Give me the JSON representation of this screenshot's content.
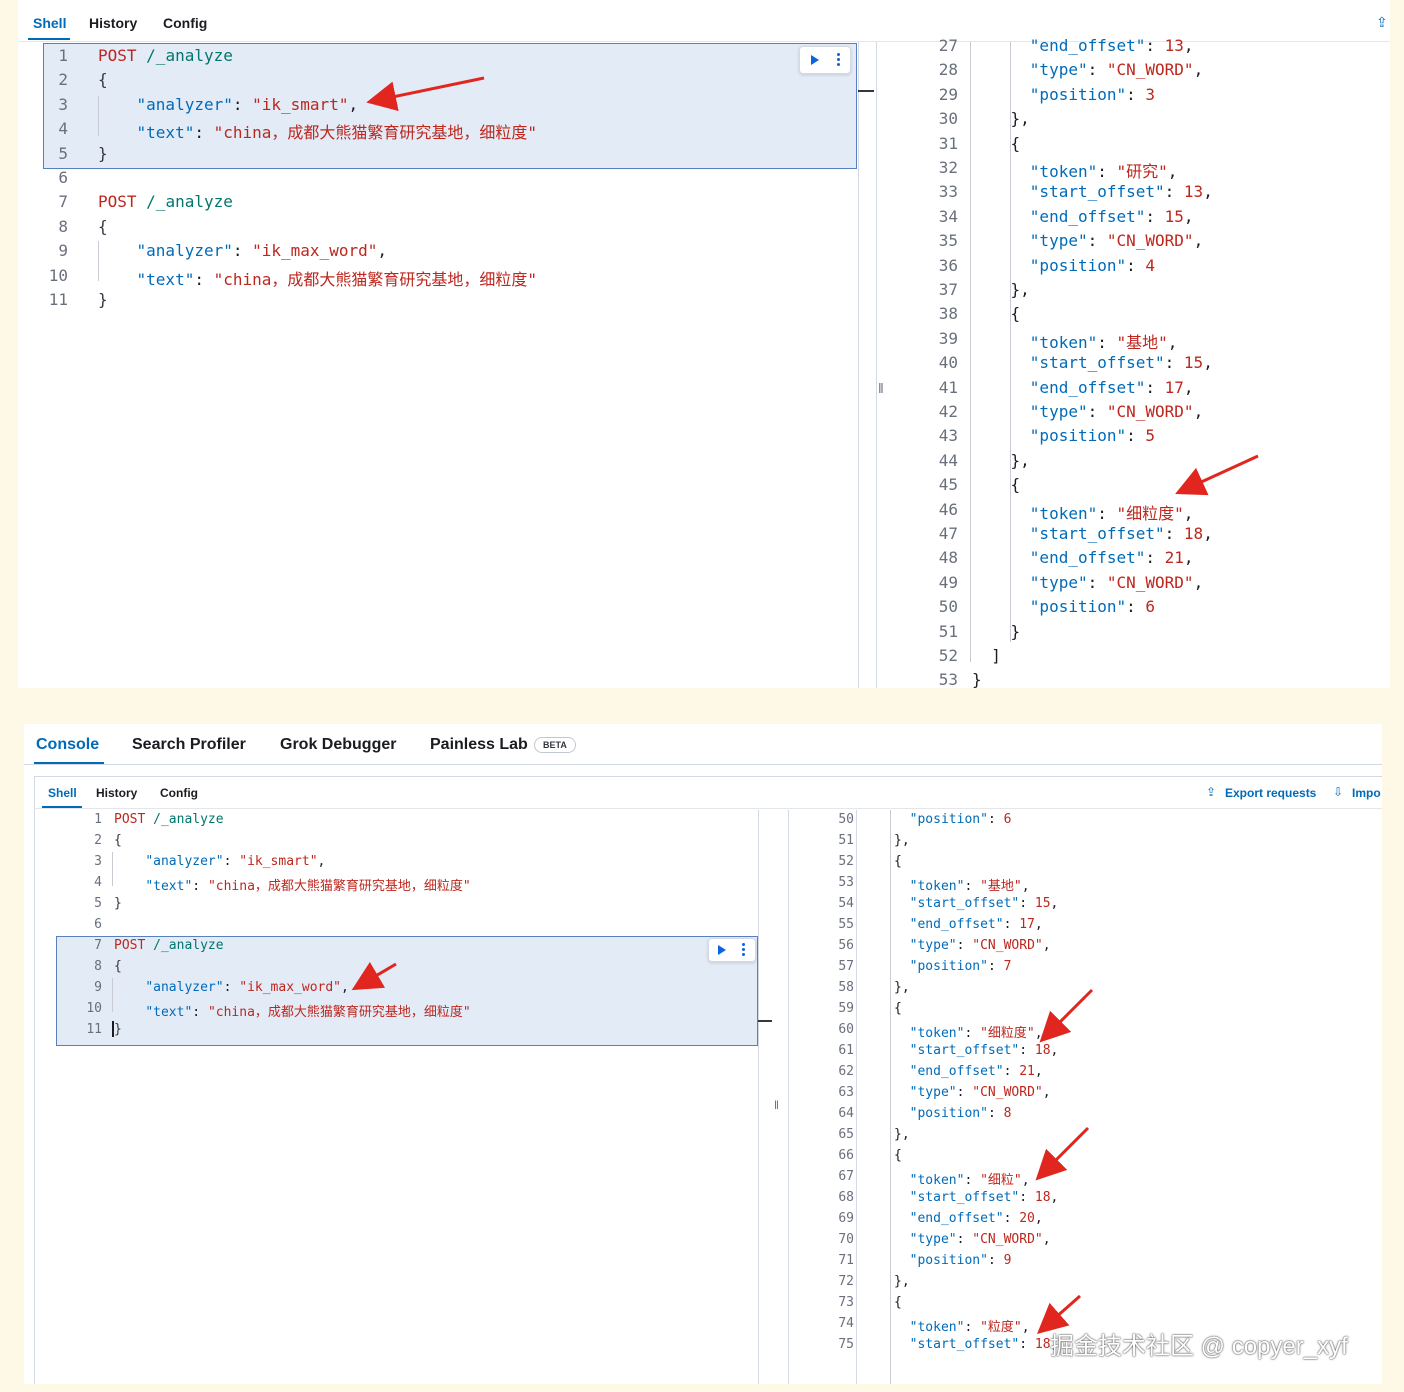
{
  "top": {
    "tabs": [
      "Shell",
      "History",
      "Config"
    ],
    "active_tab": "Shell",
    "left_lines": [
      {
        "n": "1",
        "html": "<span class='k-method'>POST</span> <span class='k-url'>/_analyze</span>"
      },
      {
        "n": "2",
        "html": "<span class='k-punc'>{</span>"
      },
      {
        "n": "3",
        "html": "    <span class='k-key'>\"analyzer\"</span>: <span class='k-str'>\"ik_smart\"</span>,"
      },
      {
        "n": "4",
        "html": "    <span class='k-key'>\"text\"</span>: <span class='k-str'>\"china，成都大熊猫繁育研究基地，细粒度\"</span>"
      },
      {
        "n": "5",
        "html": "<span class='k-punc'>}</span>"
      },
      {
        "n": "6",
        "html": ""
      },
      {
        "n": "7",
        "html": "<span class='k-method'>POST</span> <span class='k-url'>/_analyze</span>"
      },
      {
        "n": "8",
        "html": "<span class='k-punc'>{</span>"
      },
      {
        "n": "9",
        "html": "    <span class='k-key'>\"analyzer\"</span>: <span class='k-str'>\"ik_max_word\"</span>,"
      },
      {
        "n": "10",
        "html": "    <span class='k-key'>\"text\"</span>: <span class='k-str'>\"china，成都大熊猫繁育研究基地，细粒度\"</span>"
      },
      {
        "n": "11",
        "html": "<span class='k-punc'>}</span>"
      }
    ],
    "right_lines": [
      {
        "n": "27",
        "html": "      <span class='k-key'>\"end_offset\"</span>: <span class='k-num'>13</span>,"
      },
      {
        "n": "28",
        "html": "      <span class='k-key'>\"type\"</span>: <span class='k-str'>\"CN_WORD\"</span>,"
      },
      {
        "n": "29",
        "html": "      <span class='k-key'>\"position\"</span>: <span class='k-num'>3</span>"
      },
      {
        "n": "30",
        "html": "    },"
      },
      {
        "n": "31",
        "html": "    {"
      },
      {
        "n": "32",
        "html": "      <span class='k-key'>\"token\"</span>: <span class='k-str'>\"研究\"</span>,"
      },
      {
        "n": "33",
        "html": "      <span class='k-key'>\"start_offset\"</span>: <span class='k-num'>13</span>,"
      },
      {
        "n": "34",
        "html": "      <span class='k-key'>\"end_offset\"</span>: <span class='k-num'>15</span>,"
      },
      {
        "n": "35",
        "html": "      <span class='k-key'>\"type\"</span>: <span class='k-str'>\"CN_WORD\"</span>,"
      },
      {
        "n": "36",
        "html": "      <span class='k-key'>\"position\"</span>: <span class='k-num'>4</span>"
      },
      {
        "n": "37",
        "html": "    },"
      },
      {
        "n": "38",
        "html": "    {"
      },
      {
        "n": "39",
        "html": "      <span class='k-key'>\"token\"</span>: <span class='k-str'>\"基地\"</span>,"
      },
      {
        "n": "40",
        "html": "      <span class='k-key'>\"start_offset\"</span>: <span class='k-num'>15</span>,"
      },
      {
        "n": "41",
        "html": "      <span class='k-key'>\"end_offset\"</span>: <span class='k-num'>17</span>,"
      },
      {
        "n": "42",
        "html": "      <span class='k-key'>\"type\"</span>: <span class='k-str'>\"CN_WORD\"</span>,"
      },
      {
        "n": "43",
        "html": "      <span class='k-key'>\"position\"</span>: <span class='k-num'>5</span>"
      },
      {
        "n": "44",
        "html": "    },"
      },
      {
        "n": "45",
        "html": "    {"
      },
      {
        "n": "46",
        "html": "      <span class='k-key'>\"token\"</span>: <span class='k-str'>\"细粒度\"</span>,"
      },
      {
        "n": "47",
        "html": "      <span class='k-key'>\"start_offset\"</span>: <span class='k-num'>18</span>,"
      },
      {
        "n": "48",
        "html": "      <span class='k-key'>\"end_offset\"</span>: <span class='k-num'>21</span>,"
      },
      {
        "n": "49",
        "html": "      <span class='k-key'>\"type\"</span>: <span class='k-str'>\"CN_WORD\"</span>,"
      },
      {
        "n": "50",
        "html": "      <span class='k-key'>\"position\"</span>: <span class='k-num'>6</span>"
      },
      {
        "n": "51",
        "html": "    }"
      },
      {
        "n": "52",
        "html": "  ]"
      },
      {
        "n": "53",
        "html": "}"
      }
    ]
  },
  "bottom": {
    "app_tabs": [
      "Console",
      "Search Profiler",
      "Grok Debugger",
      "Painless Lab"
    ],
    "active_app_tab": "Console",
    "beta_badge": "BETA",
    "tabs": [
      "Shell",
      "History",
      "Config"
    ],
    "active_tab": "Shell",
    "export_label": "Export requests",
    "import_label": "Impo",
    "left_lines": [
      {
        "n": "1",
        "html": "<span class='k-method'>POST</span> <span class='k-url'>/_analyze</span>"
      },
      {
        "n": "2",
        "html": "<span class='k-punc'>{</span>"
      },
      {
        "n": "3",
        "html": "    <span class='k-key'>\"analyzer\"</span>: <span class='k-str'>\"ik_smart\"</span>,"
      },
      {
        "n": "4",
        "html": "    <span class='k-key'>\"text\"</span>: <span class='k-str'>\"china，成都大熊猫繁育研究基地，细粒度\"</span>"
      },
      {
        "n": "5",
        "html": "<span class='k-punc'>}</span>"
      },
      {
        "n": "6",
        "html": ""
      },
      {
        "n": "7",
        "html": "<span class='k-method'>POST</span> <span class='k-url'>/_analyze</span>"
      },
      {
        "n": "8",
        "html": "<span class='k-punc'>{</span>"
      },
      {
        "n": "9",
        "html": "    <span class='k-key'>\"analyzer\"</span>: <span class='k-str'>\"ik_max_word\"</span>,"
      },
      {
        "n": "10",
        "html": "    <span class='k-key'>\"text\"</span>: <span class='k-str'>\"china，成都大熊猫繁育研究基地，细粒度\"</span>"
      },
      {
        "n": "11",
        "html": "<span class='k-punc'>}</span>"
      }
    ],
    "right_lines": [
      {
        "n": "50",
        "html": "  <span class='k-key'>\"position\"</span>: <span class='k-num'>6</span>"
      },
      {
        "n": "51",
        "html": "},"
      },
      {
        "n": "52",
        "html": "{"
      },
      {
        "n": "53",
        "html": "  <span class='k-key'>\"token\"</span>: <span class='k-str'>\"基地\"</span>,"
      },
      {
        "n": "54",
        "html": "  <span class='k-key'>\"start_offset\"</span>: <span class='k-num'>15</span>,"
      },
      {
        "n": "55",
        "html": "  <span class='k-key'>\"end_offset\"</span>: <span class='k-num'>17</span>,"
      },
      {
        "n": "56",
        "html": "  <span class='k-key'>\"type\"</span>: <span class='k-str'>\"CN_WORD\"</span>,"
      },
      {
        "n": "57",
        "html": "  <span class='k-key'>\"position\"</span>: <span class='k-num'>7</span>"
      },
      {
        "n": "58",
        "html": "},"
      },
      {
        "n": "59",
        "html": "{"
      },
      {
        "n": "60",
        "html": "  <span class='k-key'>\"token\"</span>: <span class='k-str'>\"细粒度\"</span>,"
      },
      {
        "n": "61",
        "html": "  <span class='k-key'>\"start_offset\"</span>: <span class='k-num'>18</span>,"
      },
      {
        "n": "62",
        "html": "  <span class='k-key'>\"end_offset\"</span>: <span class='k-num'>21</span>,"
      },
      {
        "n": "63",
        "html": "  <span class='k-key'>\"type\"</span>: <span class='k-str'>\"CN_WORD\"</span>,"
      },
      {
        "n": "64",
        "html": "  <span class='k-key'>\"position\"</span>: <span class='k-num'>8</span>"
      },
      {
        "n": "65",
        "html": "},"
      },
      {
        "n": "66",
        "html": "{"
      },
      {
        "n": "67",
        "html": "  <span class='k-key'>\"token\"</span>: <span class='k-str'>\"细粒\"</span>,"
      },
      {
        "n": "68",
        "html": "  <span class='k-key'>\"start_offset\"</span>: <span class='k-num'>18</span>,"
      },
      {
        "n": "69",
        "html": "  <span class='k-key'>\"end_offset\"</span>: <span class='k-num'>20</span>,"
      },
      {
        "n": "70",
        "html": "  <span class='k-key'>\"type\"</span>: <span class='k-str'>\"CN_WORD\"</span>,"
      },
      {
        "n": "71",
        "html": "  <span class='k-key'>\"position\"</span>: <span class='k-num'>9</span>"
      },
      {
        "n": "72",
        "html": "},"
      },
      {
        "n": "73",
        "html": "{"
      },
      {
        "n": "74",
        "html": "  <span class='k-key'>\"token\"</span>: <span class='k-str'>\"粒度\"</span>,"
      },
      {
        "n": "75",
        "html": "  <span class='k-key'>\"start_offset\"</span>: <span class='k-num'>18</span>,"
      }
    ]
  },
  "watermark": "掘金技术社区 @ copyer_xyf",
  "colors": {
    "accent": "#006bb8",
    "annotation_arrow": "#e0261f",
    "selection": "#e3ebf7"
  }
}
